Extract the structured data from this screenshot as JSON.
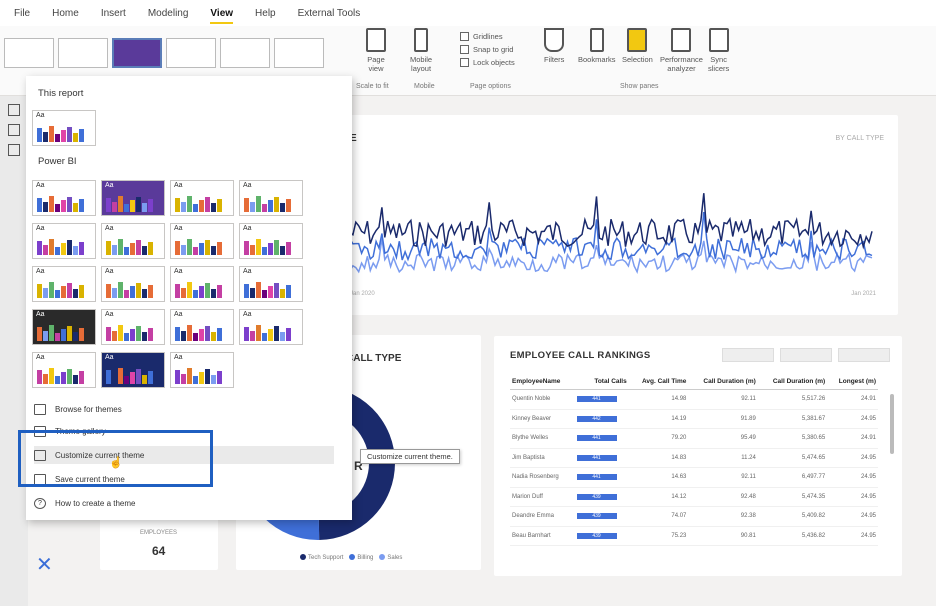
{
  "menu": [
    "File",
    "Home",
    "Insert",
    "Modeling",
    "View",
    "Help",
    "External Tools"
  ],
  "menu_active": "View",
  "ribbon": {
    "page_view": "Page\nview",
    "mobile_layout": "Mobile\nlayout",
    "gridlines": "Gridlines",
    "snap_to_grid": "Snap to grid",
    "lock_objects": "Lock objects",
    "filters": "Filters",
    "bookmarks": "Bookmarks",
    "selection": "Selection",
    "performance": "Performance\nanalyzer",
    "sync": "Sync\nslicers",
    "cap_scale": "Scale to fit",
    "cap_mobile": "Mobile",
    "cap_page": "Page options",
    "cap_panes": "Show panes"
  },
  "panel": {
    "this_report": "This report",
    "power_bi": "Power BI",
    "browse": "Browse for themes",
    "gallery": "Theme gallery",
    "customize": "Customize current theme",
    "save": "Save current theme",
    "how_to": "How to create a theme"
  },
  "tooltip": "Customize current theme.",
  "line_chart": {
    "title": "E",
    "right_label": "BY CALL TYPE",
    "x_start": "Jan 2020",
    "x_mid": "",
    "x_mid2": "",
    "x_end": "Jan 2021"
  },
  "donut": {
    "title": "CALL TYPE",
    "subtitle": "",
    "center": "R",
    "legend": [
      "Tech Support",
      "Billing",
      "Sales"
    ],
    "colors": [
      "#1a2a6c",
      "#3f6fd8",
      "#7b9cf0"
    ]
  },
  "kpi": {
    "label": "EMPLOYEES",
    "value": "64"
  },
  "rankings": {
    "title": "EMPLOYEE CALL RANKINGS",
    "slicers": [
      "",
      "",
      ""
    ],
    "columns": [
      "EmployeeName",
      "Total Calls",
      "Avg. Call Time",
      "Call Duration (m)",
      "Call Duration (m)",
      "Longest (m)"
    ],
    "rows": [
      [
        "Quentin Noble",
        "441",
        "14.98",
        "92.11",
        "5,517.26",
        "24.91"
      ],
      [
        "Kinney Beaver",
        "442",
        "14.19",
        "91.89",
        "5,381.67",
        "24.95"
      ],
      [
        "Blythe Welles",
        "441",
        "79.20",
        "95.49",
        "5,380.65",
        "24.91"
      ],
      [
        "Jim Baptista",
        "441",
        "14.83",
        "11.24",
        "5,474.65",
        "24.95"
      ],
      [
        "Nadia Rosenberg",
        "441",
        "14.63",
        "92.11",
        "6,497.77",
        "24.95"
      ],
      [
        "Marion Duff",
        "439",
        "14.12",
        "92.48",
        "5,474.35",
        "24.95"
      ],
      [
        "Deandre Emma",
        "439",
        "74.07",
        "92.38",
        "5,409.82",
        "24.95"
      ],
      [
        "Beau Barnhart",
        "439",
        "75.23",
        "90.81",
        "5,436.82",
        "24.95"
      ]
    ]
  }
}
